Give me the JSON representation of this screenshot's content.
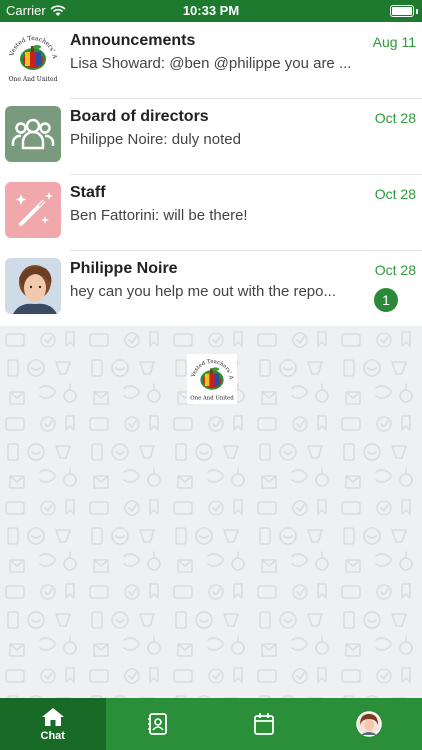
{
  "status_bar": {
    "carrier": "Carrier",
    "time": "10:33 PM",
    "battery_level": 1.0
  },
  "chats": [
    {
      "name": "Announcements",
      "preview": "Lisa Showard: @ben @philippe you are ...",
      "date": "Aug 11",
      "avatar": "association-logo",
      "unread": null
    },
    {
      "name": "Board of directors",
      "preview": "Philippe Noire: duly noted",
      "date": "Oct 28",
      "avatar": "group-people-icon",
      "avatar_color": "#7a9a7e",
      "unread": null
    },
    {
      "name": "Staff",
      "preview": "Ben Fattorini: will be there!",
      "date": "Oct 28",
      "avatar": "magic-wand-icon",
      "avatar_color": "#f0a8ac",
      "unread": null
    },
    {
      "name": "Philippe Noire",
      "preview": "hey can you help me out with the repo...",
      "date": "Oct 28",
      "avatar": "user-photo",
      "unread": "1"
    }
  ],
  "logo": {
    "top_text": "Vested Teachers' Association",
    "bottom_text": "One And United"
  },
  "tabs": [
    {
      "label": "Chat",
      "icon": "home-icon",
      "active": true
    },
    {
      "label": "",
      "icon": "contacts-icon",
      "active": false
    },
    {
      "label": "",
      "icon": "calendar-icon",
      "active": false
    },
    {
      "label": "",
      "icon": "profile-avatar",
      "active": false
    }
  ],
  "colors": {
    "brand_green": "#2b8f3a",
    "date_green": "#2e9a3c",
    "active_tab": "#1a6a27"
  }
}
